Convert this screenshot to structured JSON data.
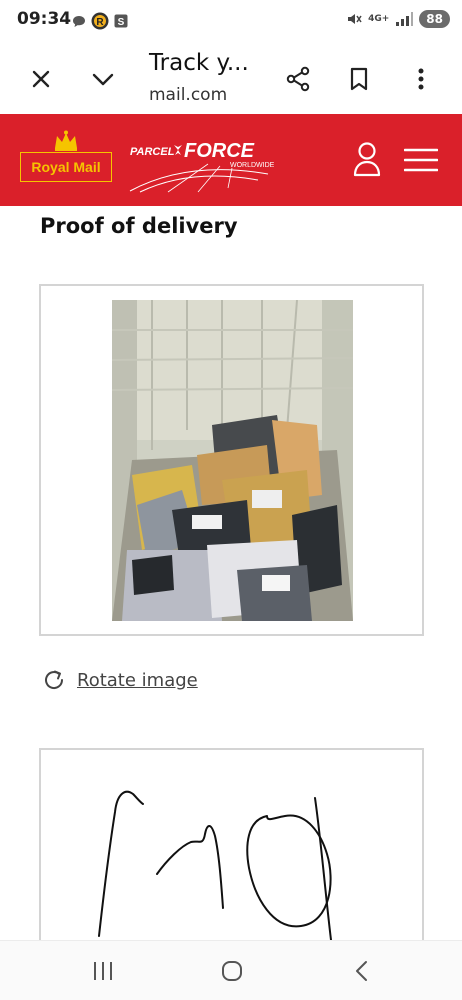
{
  "status_bar": {
    "time": "09:34",
    "network": "4G+",
    "battery": "88",
    "icons": [
      "chat-bubble-icon",
      "reward-app-icon",
      "s-app-icon",
      "mute-icon",
      "signal-icon"
    ]
  },
  "browser": {
    "title": "Track y...",
    "url": "mail.com",
    "icons": [
      "close-icon",
      "chevron-down-icon",
      "share-icon",
      "bookmark-icon",
      "more-vert-icon"
    ]
  },
  "header": {
    "brand_royal_mail": "Royal Mail",
    "brand_parcel": "PARCEL",
    "brand_force": "FORCE",
    "brand_worldwide": "WORLDWIDE",
    "colors": {
      "header_red": "#da202a",
      "royal_mail_yellow": "#f5c400"
    }
  },
  "content": {
    "heading": "Proof of delivery",
    "rotate_label": "Rotate image",
    "photo_alt": "Photo of parcels in delivery cage",
    "signature_alt": "Customer signature"
  },
  "nav_bar": {
    "icons": [
      "recents-icon",
      "home-icon",
      "back-icon"
    ]
  }
}
